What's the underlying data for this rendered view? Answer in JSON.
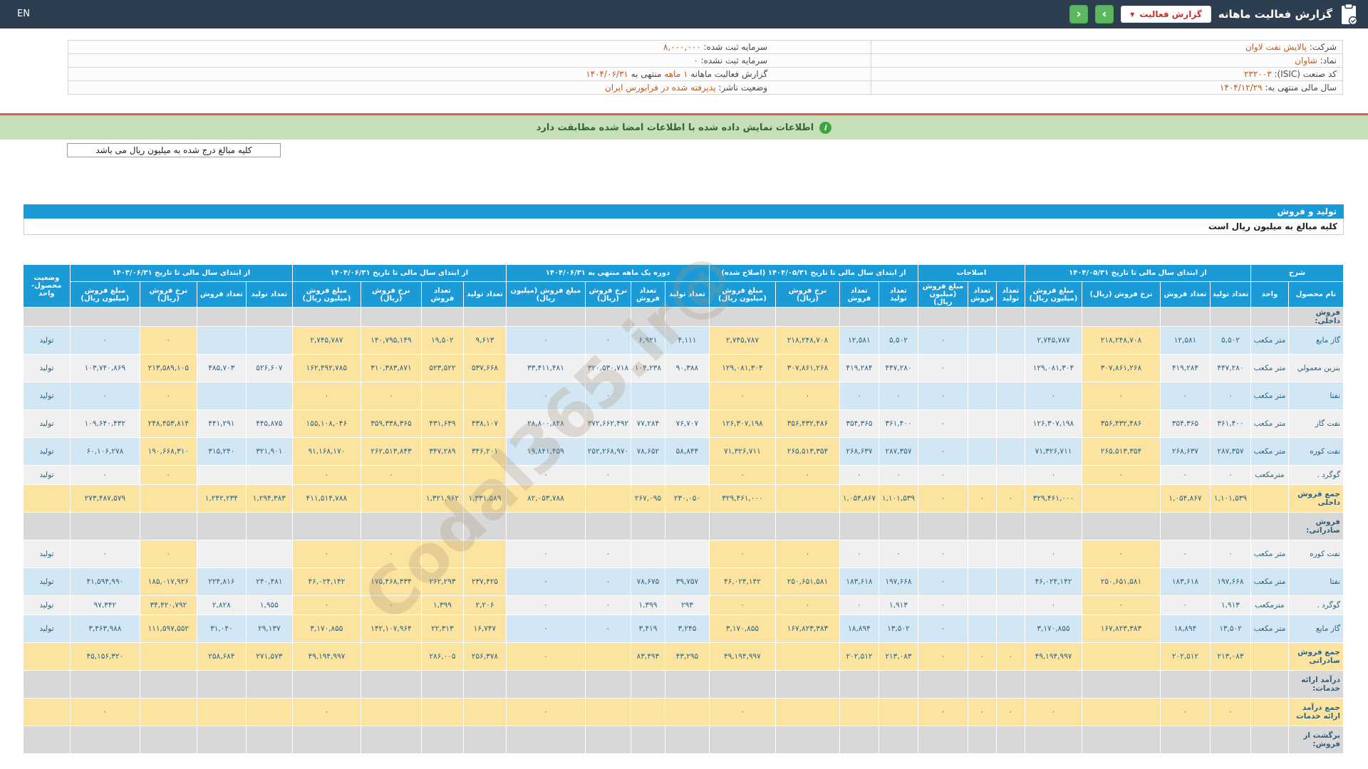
{
  "header": {
    "en_label": "EN",
    "title": "گزارش فعالیت ماهانه",
    "dropdown_label": "گزارش فعالیت",
    "dropdown_caret": "▼",
    "nav_next": "›",
    "nav_prev": "‹",
    "accent_green": "#5cb85c",
    "accent_red": "#c9302c",
    "bar_color": "#2d3e50"
  },
  "company_info": {
    "rows": [
      {
        "right": [
          {
            "t": "شرکت:",
            "k": "lab"
          },
          {
            "t": "پالایش نفت لاوان",
            "k": "val"
          }
        ],
        "left": [
          {
            "t": "سرمایه ثبت شده:",
            "k": "lab"
          },
          {
            "t": "۸,۰۰۰,۰۰۰",
            "k": "val"
          }
        ]
      },
      {
        "right": [
          {
            "t": "نماد:",
            "k": "lab"
          },
          {
            "t": "شاوان",
            "k": "val"
          }
        ],
        "left": [
          {
            "t": "سرمایه ثبت نشده:",
            "k": "lab"
          },
          {
            "t": "۰",
            "k": "val"
          }
        ]
      },
      {
        "right": [
          {
            "t": "کد صنعت (ISIC):",
            "k": "lab"
          },
          {
            "t": "۲۳۲۰۰۳",
            "k": "val"
          }
        ],
        "left": [
          {
            "t": "گزارش فعالیت ماهانه",
            "k": "lab"
          },
          {
            "t": "۱ ماهه",
            "k": "val"
          },
          {
            "t": "منتهی به",
            "k": "lab"
          },
          {
            "t": "۱۴۰۴/۰۶/۳۱",
            "k": "val"
          }
        ]
      },
      {
        "right": [
          {
            "t": "سال مالی منتهی به:",
            "k": "lab"
          },
          {
            "t": "۱۴۰۴/۱۲/۲۹",
            "k": "val"
          }
        ],
        "left": [
          {
            "t": "وضعیت ناشر:",
            "k": "lab"
          },
          {
            "t": "پذیرفته شده در فرابورس ایران",
            "k": "val"
          }
        ]
      }
    ]
  },
  "notice": {
    "text": "اطلاعات نمایش داده شده با اطلاعات امضا شده مطابقت دارد",
    "icon_letter": "i"
  },
  "unit_note": "کلیه مبالغ درج شده به میلیون ریال می باشد",
  "section": {
    "title": "تولید و فروش",
    "subtitle": "کلیه مبالغ به میلیون ریال است"
  },
  "watermark": "@Codal365.ir",
  "table": {
    "headers": {
      "sharh": "شرح",
      "product": "نام محصول",
      "unit": "واحد",
      "status": "وضعیت محصول-واحد",
      "g1": "از ابتدای سال مالی تا تاریخ ۱۴۰۴/۰۵/۳۱",
      "g2": "اصلاحات",
      "g3": "از ابتدای سال مالی تا تاریخ ۱۴۰۴/۰۵/۳۱ (اصلاح شده)",
      "g4": "دوره یک ماهه منتهی به ۱۴۰۴/۰۶/۳۱",
      "g5": "از ابتدای سال مالی تا تاریخ ۱۴۰۴/۰۶/۳۱",
      "g6": "از ابتدای سال مالی تا تاریخ ۱۴۰۳/۰۶/۳۱",
      "qty_prod": "تعداد تولید",
      "qty_sale": "تعداد فروش",
      "rate": "نرخ فروش (ریال)",
      "amount": "مبلغ فروش (میلیون ریال)"
    },
    "rows": [
      {
        "type": "section",
        "compact": true,
        "label": "فروش داخلی:"
      },
      {
        "type": "data",
        "shade": "blue",
        "name": "گاز مایع",
        "unit": "متر مکعب",
        "status": "تولید",
        "g1": [
          "۵,۵۰۲",
          "۱۲,۵۸۱",
          "۲۱۸,۲۴۸,۷۰۸",
          "۲,۷۴۵,۷۸۷"
        ],
        "g2": [
          "",
          "",
          "۰"
        ],
        "g3": [
          "۵,۵۰۲",
          "۱۲,۵۸۱",
          "۲۱۸,۲۴۸,۷۰۸",
          "۲,۷۴۵,۷۸۷"
        ],
        "g4": [
          "۴,۱۱۱",
          "۶,۹۲۱",
          "۰",
          "۰"
        ],
        "g5": [
          "۹,۶۱۳",
          "۱۹,۵۰۲",
          "۱۴۰,۷۹۵,۱۴۹",
          "۲,۷۴۵,۷۸۷"
        ],
        "g6": [
          "",
          "",
          "۰",
          "۰"
        ]
      },
      {
        "type": "data",
        "shade": "white",
        "name": "بنزین معمولي",
        "unit": "متر مکعب",
        "status": "تولید",
        "g1": [
          "۴۴۷,۲۸۰",
          "۴۱۹,۲۸۴",
          "۳۰۷,۸۶۱,۲۶۸",
          "۱۲۹,۰۸۱,۳۰۴"
        ],
        "g2": [
          "",
          "",
          "۰"
        ],
        "g3": [
          "۴۴۷,۲۸۰",
          "۴۱۹,۲۸۴",
          "۳۰۷,۸۶۱,۲۶۸",
          "۱۲۹,۰۸۱,۳۰۴"
        ],
        "g4": [
          "۹۰,۳۸۸",
          "۱۰۴,۲۳۸",
          "۳۲۰,۵۳۰,۷۱۸",
          "۳۳,۴۱۱,۴۸۱"
        ],
        "g5": [
          "۵۳۷,۶۶۸",
          "۵۲۳,۵۲۲",
          "۳۱۰,۳۸۳,۸۷۱",
          "۱۶۲,۴۹۲,۷۸۵"
        ],
        "g6": [
          "۵۲۶,۶۰۷",
          "۴۸۵,۷۰۳",
          "۲۱۳,۵۸۹,۱۰۵",
          "۱۰۳,۷۴۰,۸۶۹"
        ]
      },
      {
        "type": "data",
        "shade": "blue",
        "name": "نفتا",
        "unit": "متر مکعب",
        "status": "تولید",
        "g1": [
          "۰",
          "۰",
          "۰",
          "۰"
        ],
        "g2": [
          "",
          "",
          "۰"
        ],
        "g3": [
          "۰",
          "۰",
          "۰",
          "۰"
        ],
        "g4": [
          "",
          "",
          "۰",
          "۰"
        ],
        "g5": [
          "",
          "",
          "۰",
          "۰"
        ],
        "g6": [
          "",
          "",
          "۰",
          "۰"
        ]
      },
      {
        "type": "data",
        "shade": "white",
        "name": "نفت گاز",
        "unit": "متر مکعب",
        "status": "تولید",
        "g1": [
          "۳۶۱,۴۰۰",
          "۳۵۴,۳۶۵",
          "۳۵۶,۴۳۲,۴۸۶",
          "۱۲۶,۳۰۷,۱۹۸"
        ],
        "g2": [
          "",
          "",
          "۰"
        ],
        "g3": [
          "۳۶۱,۴۰۰",
          "۳۵۴,۳۶۵",
          "۳۵۶,۴۳۲,۴۸۶",
          "۱۲۶,۳۰۷,۱۹۸"
        ],
        "g4": [
          "۷۶,۷۰۷",
          "۷۷,۲۸۴",
          "۳۷۲,۶۶۲,۴۹۲",
          "۲۸,۸۰۰,۸۴۸"
        ],
        "g5": [
          "۴۳۸,۱۰۷",
          "۴۳۱,۶۴۹",
          "۳۵۹,۳۳۸,۳۶۵",
          "۱۵۵,۱۰۸,۰۴۶"
        ],
        "g6": [
          "۴۴۵,۸۷۵",
          "۴۴۱,۲۹۱",
          "۲۴۸,۴۵۳,۸۱۴",
          "۱۰۹,۶۴۰,۴۳۲"
        ]
      },
      {
        "type": "data",
        "shade": "blue",
        "name": "نفت کوره",
        "unit": "متر مکعب",
        "status": "تولید",
        "g1": [
          "۲۸۷,۳۵۷",
          "۲۶۸,۶۳۷",
          "۲۶۵,۵۱۳,۳۵۴",
          "۷۱,۳۲۶,۷۱۱"
        ],
        "g2": [
          "",
          "",
          "۰"
        ],
        "g3": [
          "۲۸۷,۳۵۷",
          "۲۶۸,۶۳۷",
          "۲۶۵,۵۱۳,۳۵۴",
          "۷۱,۳۲۶,۷۱۱"
        ],
        "g4": [
          "۵۸,۸۴۴",
          "۷۸,۶۵۲",
          "۲۵۲,۲۶۸,۹۷۰",
          "۱۹,۸۴۱,۴۵۹"
        ],
        "g5": [
          "۳۴۶,۲۰۱",
          "۳۴۷,۲۸۹",
          "۲۶۲,۵۱۳,۸۴۳",
          "۹۱,۱۶۸,۱۷۰"
        ],
        "g6": [
          "۳۲۱,۹۰۱",
          "۳۱۵,۲۴۰",
          "۱۹۰,۶۶۸,۳۱۰",
          "۶۰,۱۰۶,۲۷۸"
        ]
      },
      {
        "type": "data",
        "shade": "white",
        "compact": true,
        "name": "گوگرد .",
        "unit": "مترمکعب",
        "status": "تولید",
        "g1": [
          "۰",
          "۰",
          "۰",
          "۰"
        ],
        "g2": [
          "",
          "",
          "۰"
        ],
        "g3": [
          "۰",
          "۰",
          "۰",
          "۰"
        ],
        "g4": [
          "",
          "",
          "۰",
          "۰"
        ],
        "g5": [
          "",
          "",
          "۰",
          "۰"
        ],
        "g6": [
          "",
          "",
          "۰",
          "۰"
        ]
      },
      {
        "type": "total",
        "name": "جمع فروش داخلی",
        "g1": [
          "۱,۱۰۱,۵۳۹",
          "۱,۰۵۴,۸۶۷",
          "",
          "۳۲۹,۴۶۱,۰۰۰"
        ],
        "g2": [
          "۰",
          "۰",
          "۰"
        ],
        "g3": [
          "۱,۱۰۱,۵۳۹",
          "۱,۰۵۴,۸۶۷",
          "",
          "۳۲۹,۴۶۱,۰۰۰"
        ],
        "g4": [
          "۲۳۰,۰۵۰",
          "۲۶۷,۰۹۵",
          "",
          "۸۲,۰۵۳,۷۸۸"
        ],
        "g5": [
          "۱,۳۳۱,۵۸۹",
          "۱,۳۲۱,۹۶۲",
          "",
          "۴۱۱,۵۱۴,۷۸۸"
        ],
        "g6": [
          "۱,۲۹۴,۳۸۳",
          "۱,۲۴۲,۲۳۴",
          "",
          "۲۷۳,۴۸۷,۵۷۹"
        ]
      },
      {
        "type": "section",
        "label": "فروش صادراتی:"
      },
      {
        "type": "data",
        "shade": "white",
        "name": "نفت کوره",
        "unit": "متر مکعب",
        "status": "تولید",
        "g1": [
          "۰",
          "۰",
          "۰",
          "۰"
        ],
        "g2": [
          "",
          "",
          "۰"
        ],
        "g3": [
          "۰",
          "۰",
          "۰",
          "۰"
        ],
        "g4": [
          "",
          "",
          "۰",
          "۰"
        ],
        "g5": [
          "",
          "",
          "۰",
          "۰"
        ],
        "g6": [
          "",
          "",
          "۰",
          "۰"
        ]
      },
      {
        "type": "data",
        "shade": "blue",
        "name": "نفتا",
        "unit": "متر مکعب",
        "status": "تولید",
        "g1": [
          "۱۹۷,۶۶۸",
          "۱۸۳,۶۱۸",
          "۲۵۰,۶۵۱,۵۸۱",
          "۴۶,۰۲۴,۱۴۲"
        ],
        "g2": [
          "",
          "",
          "۰"
        ],
        "g3": [
          "۱۹۷,۶۶۸",
          "۱۸۳,۶۱۸",
          "۲۵۰,۶۵۱,۵۸۱",
          "۴۶,۰۲۴,۱۴۲"
        ],
        "g4": [
          "۳۹,۷۵۷",
          "۷۸,۶۷۵",
          "۰",
          "۰"
        ],
        "g5": [
          "۲۳۷,۴۲۵",
          "۲۶۲,۲۹۳",
          "۱۷۵,۴۶۸,۴۳۴",
          "۴۶,۰۲۴,۱۴۲"
        ],
        "g6": [
          "۲۴۰,۴۸۱",
          "۲۲۴,۸۱۶",
          "۱۸۵,۰۱۷,۹۲۶",
          "۴۱,۵۹۴,۹۹۰"
        ]
      },
      {
        "type": "data",
        "shade": "white",
        "compact": true,
        "name": "گوگرد .",
        "unit": "مترمکعب",
        "status": "تولید",
        "g1": [
          "۱,۹۱۳",
          "۰",
          "۰",
          "۰"
        ],
        "g2": [
          "",
          "",
          "۰"
        ],
        "g3": [
          "۱,۹۱۳",
          "۰",
          "۰",
          "۰"
        ],
        "g4": [
          "۲۹۳",
          "۱,۳۹۹",
          "۰",
          "۰"
        ],
        "g5": [
          "۲,۲۰۶",
          "۱,۳۹۹",
          "۰",
          "۰"
        ],
        "g6": [
          "۱,۹۵۵",
          "۲,۸۲۸",
          "۳۴,۴۲۰,۷۹۲",
          "۹۷,۳۴۲"
        ]
      },
      {
        "type": "data",
        "shade": "blue",
        "name": "گاز مایع",
        "unit": "متر مکعب",
        "status": "تولید",
        "g1": [
          "۱۳,۵۰۲",
          "۱۸,۸۹۴",
          "۱۶۷,۸۲۳,۳۸۳",
          "۳,۱۷۰,۸۵۵"
        ],
        "g2": [
          "",
          "",
          "۰"
        ],
        "g3": [
          "۱۳,۵۰۲",
          "۱۸,۸۹۴",
          "۱۶۷,۸۲۳,۳۸۳",
          "۳,۱۷۰,۸۵۵"
        ],
        "g4": [
          "۳,۲۴۵",
          "۳,۴۱۹",
          "۰",
          "۰"
        ],
        "g5": [
          "۱۶,۷۴۷",
          "۲۲,۳۱۳",
          "۱۴۲,۱۰۷,۹۶۴",
          "۳,۱۷۰,۸۵۵"
        ],
        "g6": [
          "۲۹,۱۳۷",
          "۳۱,۰۴۰",
          "۱۱۱,۵۹۷,۵۵۲",
          "۳,۴۶۳,۹۸۸"
        ]
      },
      {
        "type": "total",
        "name": "جمع فروش صادراتی",
        "g1": [
          "۲۱۳,۰۸۳",
          "۲۰۲,۵۱۲",
          "",
          "۴۹,۱۹۴,۹۹۷"
        ],
        "g2": [
          "۰",
          "۰",
          "۰"
        ],
        "g3": [
          "۲۱۳,۰۸۳",
          "۲۰۲,۵۱۲",
          "",
          "۴۹,۱۹۴,۹۹۷"
        ],
        "g4": [
          "۴۳,۲۹۵",
          "۸۳,۴۹۳",
          "",
          "۰"
        ],
        "g5": [
          "۲۵۶,۳۷۸",
          "۲۸۶,۰۰۵",
          "",
          "۴۹,۱۹۴,۹۹۷"
        ],
        "g6": [
          "۲۷۱,۵۷۳",
          "۲۵۸,۶۸۴",
          "",
          "۴۵,۱۵۶,۳۲۰"
        ]
      },
      {
        "type": "section",
        "label": "درآمد ارائه خدمات:"
      },
      {
        "type": "total",
        "name": "جمع درآمد ارائه خدمات",
        "g1": [
          "۰",
          "۰",
          "",
          "۰"
        ],
        "g2": [
          "۰",
          "۰",
          "۰"
        ],
        "g3": [
          "",
          "",
          "",
          "۰"
        ],
        "g4": [
          "",
          "",
          "",
          "۰"
        ],
        "g5": [
          "",
          "",
          "",
          "۰"
        ],
        "g6": [
          "",
          "",
          "",
          "۰"
        ]
      },
      {
        "type": "section",
        "label": "برگشت از فروش:"
      }
    ]
  }
}
